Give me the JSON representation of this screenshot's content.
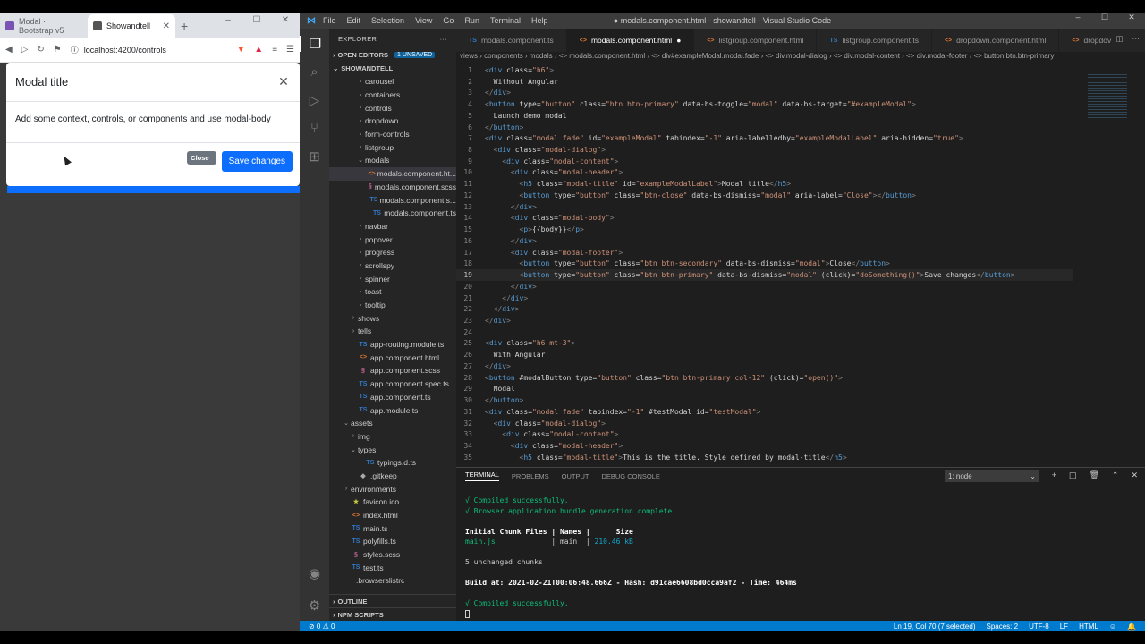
{
  "browser": {
    "tabs": [
      {
        "title": "Modal · Bootstrap v5",
        "favicon_color": "#7952b3"
      },
      {
        "title": "Showandtell",
        "favicon_color": "#555555"
      }
    ],
    "url": "localhost:4200/controls",
    "modal": {
      "title": "Modal title",
      "body": "Add some context, controls, or components and use modal-body",
      "close_label": "Close",
      "save_label": "Save changes"
    }
  },
  "vscode": {
    "menu": [
      "File",
      "Edit",
      "Selection",
      "View",
      "Go",
      "Run",
      "Terminal",
      "Help"
    ],
    "window_title": "● modals.component.html - showandtell - Visual Studio Code",
    "explorer_label": "EXPLORER",
    "open_editors_label": "OPEN EDITORS",
    "unsaved_badge": "1 UNSAVED",
    "project_label": "SHOWANDTELL",
    "outline_label": "OUTLINE",
    "npm_label": "NPM SCRIPTS",
    "tree": [
      {
        "label": "carousel",
        "type": "folder",
        "indent": 3
      },
      {
        "label": "containers",
        "type": "folder",
        "indent": 3
      },
      {
        "label": "controls",
        "type": "folder",
        "indent": 3
      },
      {
        "label": "dropdown",
        "type": "folder",
        "indent": 3
      },
      {
        "label": "form-controls",
        "type": "folder",
        "indent": 3
      },
      {
        "label": "listgroup",
        "type": "folder",
        "indent": 3
      },
      {
        "label": "modals",
        "type": "folder-open",
        "indent": 3
      },
      {
        "label": "modals.component.ht...",
        "type": "html",
        "indent": 4,
        "selected": true
      },
      {
        "label": "modals.component.scss",
        "type": "scss",
        "indent": 4
      },
      {
        "label": "modals.component.s...",
        "type": "ts",
        "indent": 4
      },
      {
        "label": "modals.component.ts",
        "type": "ts",
        "indent": 4
      },
      {
        "label": "navbar",
        "type": "folder",
        "indent": 3
      },
      {
        "label": "popover",
        "type": "folder",
        "indent": 3
      },
      {
        "label": "progress",
        "type": "folder",
        "indent": 3
      },
      {
        "label": "scrollspy",
        "type": "folder",
        "indent": 3
      },
      {
        "label": "spinner",
        "type": "folder",
        "indent": 3
      },
      {
        "label": "toast",
        "type": "folder",
        "indent": 3
      },
      {
        "label": "tooltip",
        "type": "folder",
        "indent": 3
      },
      {
        "label": "shows",
        "type": "folder",
        "indent": 2
      },
      {
        "label": "tells",
        "type": "folder",
        "indent": 2
      },
      {
        "label": "app-routing.module.ts",
        "type": "ts",
        "indent": 2
      },
      {
        "label": "app.component.html",
        "type": "html",
        "indent": 2
      },
      {
        "label": "app.component.scss",
        "type": "scss",
        "indent": 2
      },
      {
        "label": "app.component.spec.ts",
        "type": "ts",
        "indent": 2
      },
      {
        "label": "app.component.ts",
        "type": "ts",
        "indent": 2
      },
      {
        "label": "app.module.ts",
        "type": "ts",
        "indent": 2
      },
      {
        "label": "assets",
        "type": "folder-open",
        "indent": 1
      },
      {
        "label": "img",
        "type": "folder",
        "indent": 2
      },
      {
        "label": "types",
        "type": "folder-open",
        "indent": 2
      },
      {
        "label": "typings.d.ts",
        "type": "ts",
        "indent": 3
      },
      {
        "label": ".gitkeep",
        "type": "git",
        "indent": 2
      },
      {
        "label": "environments",
        "type": "folder",
        "indent": 1
      },
      {
        "label": "favicon.ico",
        "type": "star",
        "indent": 1
      },
      {
        "label": "index.html",
        "type": "html",
        "indent": 1
      },
      {
        "label": "main.ts",
        "type": "ts",
        "indent": 1
      },
      {
        "label": "polyfills.ts",
        "type": "ts",
        "indent": 1
      },
      {
        "label": "styles.scss",
        "type": "scss",
        "indent": 1
      },
      {
        "label": "test.ts",
        "type": "ts",
        "indent": 1
      },
      {
        "label": ".browserslistrc",
        "type": "plain",
        "indent": 0
      }
    ],
    "tabs": [
      {
        "label": "modals.component.ts",
        "type": "ts"
      },
      {
        "label": "modals.component.html",
        "type": "html",
        "active": true,
        "dirty": true
      },
      {
        "label": "listgroup.component.html",
        "type": "html"
      },
      {
        "label": "listgroup.component.ts",
        "type": "ts"
      },
      {
        "label": "dropdown.component.html",
        "type": "html"
      },
      {
        "label": "dropdov",
        "type": "html"
      }
    ],
    "breadcrumb": "views › components › modals › <> modals.component.html › <> div#exampleModal.modal.fade › <> div.modal-dialog › <> div.modal-content › <> div.modal-footer › <> button.btn.btn-primary",
    "code_lines": [
      "<div class=\"h6\">",
      "  Without Angular",
      "</div>",
      "<button type=\"button\" class=\"btn btn-primary\" data-bs-toggle=\"modal\" data-bs-target=\"#exampleModal\">",
      "  Launch demo modal",
      "</button>",
      "<div class=\"modal fade\" id=\"exampleModal\" tabindex=\"-1\" aria-labelledby=\"exampleModalLabel\" aria-hidden=\"true\">",
      "  <div class=\"modal-dialog\">",
      "    <div class=\"modal-content\">",
      "      <div class=\"modal-header\">",
      "        <h5 class=\"modal-title\" id=\"exampleModalLabel\">Modal title</h5>",
      "        <button type=\"button\" class=\"btn-close\" data-bs-dismiss=\"modal\" aria-label=\"Close\"></button>",
      "      </div>",
      "      <div class=\"modal-body\">",
      "        <p>{{body}}</p>",
      "      </div>",
      "      <div class=\"modal-footer\">",
      "        <button type=\"button\" class=\"btn btn-secondary\" data-bs-dismiss=\"modal\">Close</button>",
      "        <button type=\"button\" class=\"btn btn-primary\" data-bs-dismiss=\"modal\" (click)=\"doSomething()\">Save changes</button>",
      "      </div>",
      "    </div>",
      "  </div>",
      "</div>",
      "",
      "<div class=\"h6 mt-3\">",
      "  With Angular",
      "</div>",
      "<button #modalButton type=\"button\" class=\"btn btn-primary col-12\" (click)=\"open()\">",
      "  Modal",
      "</button>",
      "<div class=\"modal fade\" tabindex=\"-1\" #testModal id=\"testModal\">",
      "  <div class=\"modal-dialog\">",
      "    <div class=\"modal-content\">",
      "      <div class=\"modal-header\">",
      "        <h5 class=\"modal-title\">This is the title. Style defined by modal-title</h5>"
    ],
    "current_line": 19,
    "terminal": {
      "tabs": [
        "TERMINAL",
        "PROBLEMS",
        "OUTPUT",
        "DEBUG CONSOLE"
      ],
      "selector": "1: node",
      "lines": [
        {
          "text": "√ Compiled successfully.",
          "cls": "g"
        },
        {
          "text": "√ Browser application bundle generation complete.",
          "cls": "g"
        },
        {
          "text": "",
          "cls": ""
        },
        {
          "text": "Initial Chunk Files | Names |      Size",
          "cls": "b"
        },
        {
          "text": "main.js             | main  | 210.46 kB",
          "cls": "mix"
        },
        {
          "text": "",
          "cls": ""
        },
        {
          "text": "5 unchanged chunks",
          "cls": ""
        },
        {
          "text": "",
          "cls": ""
        },
        {
          "text": "Build at: 2021-02-21T00:06:48.666Z - Hash: d91cae6608bd0cca9af2 - Time: 464ms",
          "cls": "b"
        },
        {
          "text": "",
          "cls": ""
        },
        {
          "text": "√ Compiled successfully.",
          "cls": "g"
        }
      ]
    },
    "status": {
      "problems": "⊘ 0 ⚠ 0",
      "position": "Ln 19, Col 70 (7 selected)",
      "spaces": "Spaces: 2",
      "encoding": "UTF-8",
      "eol": "LF",
      "language": "HTML"
    }
  }
}
